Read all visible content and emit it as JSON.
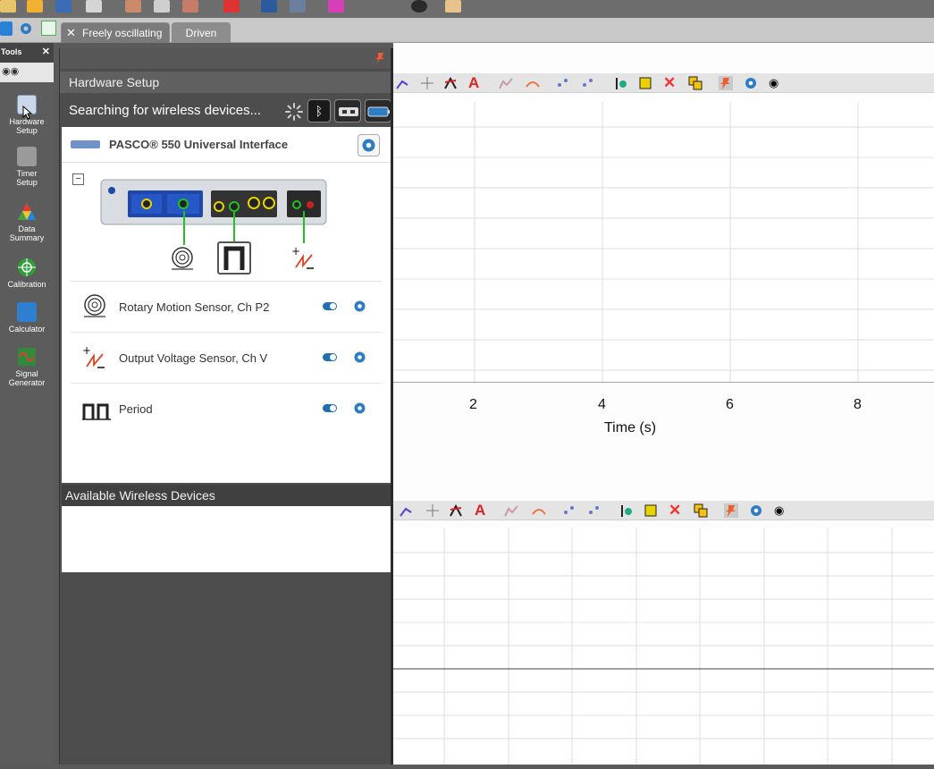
{
  "tabs": [
    {
      "label": "Freely oscillating",
      "active": true
    },
    {
      "label": "Driven",
      "active": false
    }
  ],
  "tools": {
    "header": "Tools",
    "items": [
      {
        "label_line1": "Hardware",
        "label_line2": "Setup",
        "icon": "hardware-setup-icon"
      },
      {
        "label_line1": "Timer",
        "label_line2": "Setup",
        "icon": "timer-setup-icon"
      },
      {
        "label_line1": "Data",
        "label_line2": "Summary",
        "icon": "data-summary-icon"
      },
      {
        "label_line1": "Calibration",
        "label_line2": "",
        "icon": "calibration-icon"
      },
      {
        "label_line1": "Calculator",
        "label_line2": "",
        "icon": "calculator-icon"
      },
      {
        "label_line1": "Signal",
        "label_line2": "Generator",
        "icon": "signal-generator-icon"
      }
    ]
  },
  "hardware": {
    "title": "Hardware Setup",
    "search_status": "Searching for wireless devices...",
    "interface_name": "PASCO® 550 Universal Interface",
    "sensors": [
      {
        "name": "Rotary Motion Sensor, Ch P2",
        "enabled": true
      },
      {
        "name": "Output Voltage Sensor, Ch V",
        "enabled": true
      },
      {
        "name": "Period",
        "enabled": true
      }
    ],
    "available_title": "Available Wireless Devices"
  },
  "graph1": {
    "x_ticks": [
      "2",
      "4",
      "6",
      "8"
    ],
    "x_title": "Time (s)"
  },
  "colors": {
    "accent_blue": "#1f6fb2",
    "panel_dark": "#4d4d4d",
    "wire_green": "#22c022"
  }
}
